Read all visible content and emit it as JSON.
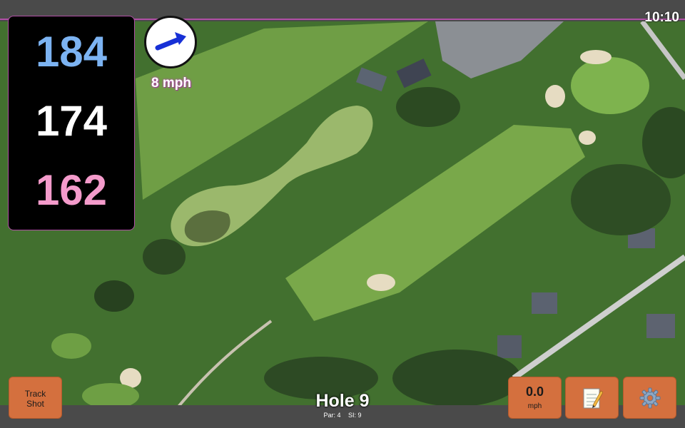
{
  "clock": "10:10",
  "distances": {
    "back": "184",
    "middle": "174",
    "front": "162"
  },
  "wind": {
    "speed": "8 mph",
    "direction_icon": "wind-arrow-icon"
  },
  "hole": {
    "title": "Hole 9",
    "par": "Par: 4",
    "stroke_index": "SI: 9"
  },
  "buttons": {
    "track_shot_line1": "Track",
    "track_shot_line2": "Shot",
    "speed_value": "0.0",
    "speed_unit": "mph",
    "notes_icon": "notepad-icon",
    "settings_icon": "gear-icon"
  },
  "colors": {
    "back": "#7cb3f2",
    "middle": "#ffffff",
    "front": "#f49bcb",
    "accent": "#b04fa6",
    "button": "#d4703e"
  }
}
